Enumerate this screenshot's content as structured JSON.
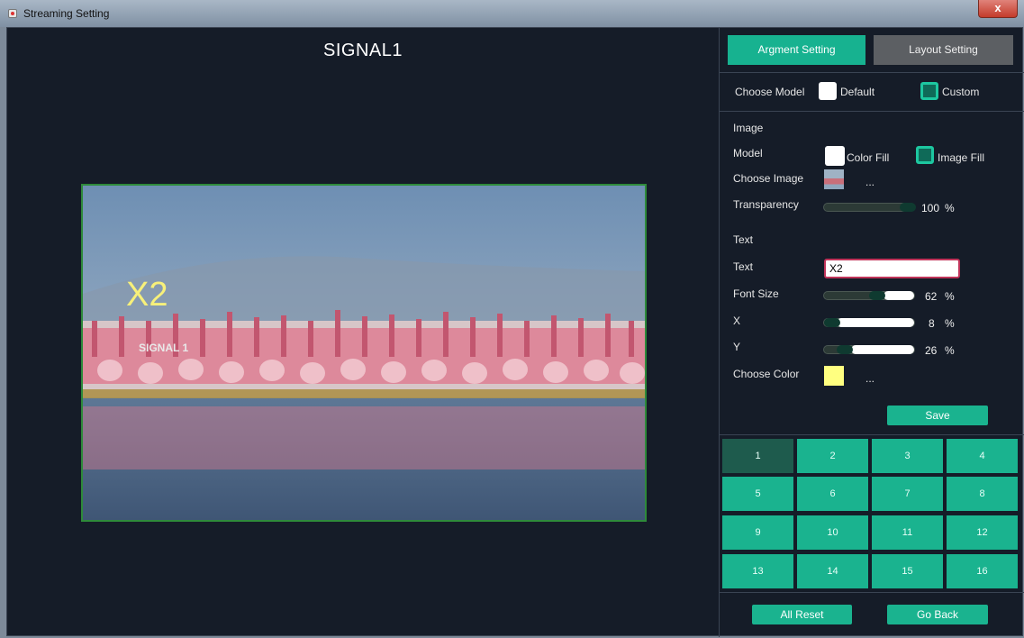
{
  "window": {
    "title": "Streaming Setting",
    "close_label": "x"
  },
  "preview": {
    "title": "SIGNAL1",
    "overlay_text": "X2",
    "signal_label": "SIGNAL 1"
  },
  "tabs": [
    {
      "label": "Argment Setting",
      "active": true
    },
    {
      "label": "Layout Setting",
      "active": false
    }
  ],
  "choose_model": {
    "label": "Choose Model",
    "options": [
      "Default",
      "Custom"
    ],
    "selected": "Custom"
  },
  "image": {
    "section_label": "Image",
    "model_label": "Model",
    "model_options": [
      "Color Fill",
      "Image Fill"
    ],
    "model_selected": "Image Fill",
    "choose_image_label": "Choose Image",
    "browse_label": "...",
    "transparency_label": "Transparency",
    "transparency_value": 100,
    "transparency_unit": "%"
  },
  "text": {
    "section_label": "Text",
    "text_label": "Text",
    "text_value": "X2",
    "font_size_label": "Font Size",
    "font_size_value": 62,
    "x_label": "X",
    "x_value": 8,
    "y_label": "Y",
    "y_value": 26,
    "unit": "%",
    "choose_color_label": "Choose Color",
    "color": "#ffff80",
    "browse_label": "..."
  },
  "save_label": "Save",
  "layout_grid": [
    "1",
    "2",
    "3",
    "4",
    "5",
    "6",
    "7",
    "8",
    "9",
    "10",
    "11",
    "12",
    "13",
    "14",
    "15",
    "16"
  ],
  "active_cell": "1",
  "footer": {
    "reset_label": "All Reset",
    "back_label": "Go Back"
  },
  "colors": {
    "accent": "#1ab38f",
    "panel_bg": "#151c28",
    "text_color": "#ffff80"
  }
}
